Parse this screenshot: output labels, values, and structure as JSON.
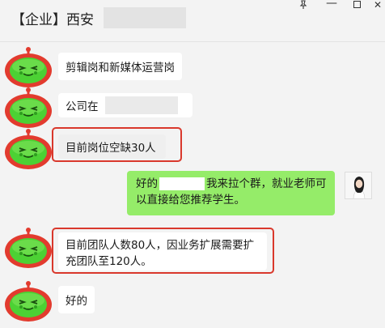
{
  "window": {
    "title": "【企业】西安",
    "pin_icon": "pin-icon",
    "minimize_icon": "minimize-icon",
    "maximize_icon": "maximize-icon",
    "close_icon": "close-icon"
  },
  "messages": [
    {
      "sender": "contact",
      "text": "剪辑岗和新媒体运营岗"
    },
    {
      "sender": "contact",
      "text": "公司在"
    },
    {
      "sender": "contact",
      "text": "目前岗位空缺30人",
      "highlighted": true
    },
    {
      "sender": "me",
      "text_before": "好的",
      "text_after": "我来拉个群，就业老师可",
      "line2": "以直接给您推荐学生。"
    },
    {
      "sender": "contact",
      "line1": "目前团队人数80人，因业务扩展需要扩",
      "line2": "充团队至120人。",
      "highlighted": true
    },
    {
      "sender": "contact",
      "text": "好的"
    }
  ],
  "colors": {
    "highlight_frame": "#d9382c",
    "my_bubble": "#95ec69",
    "contact_bubble": "#ffffff",
    "frog_avatar": "#4cd134"
  }
}
